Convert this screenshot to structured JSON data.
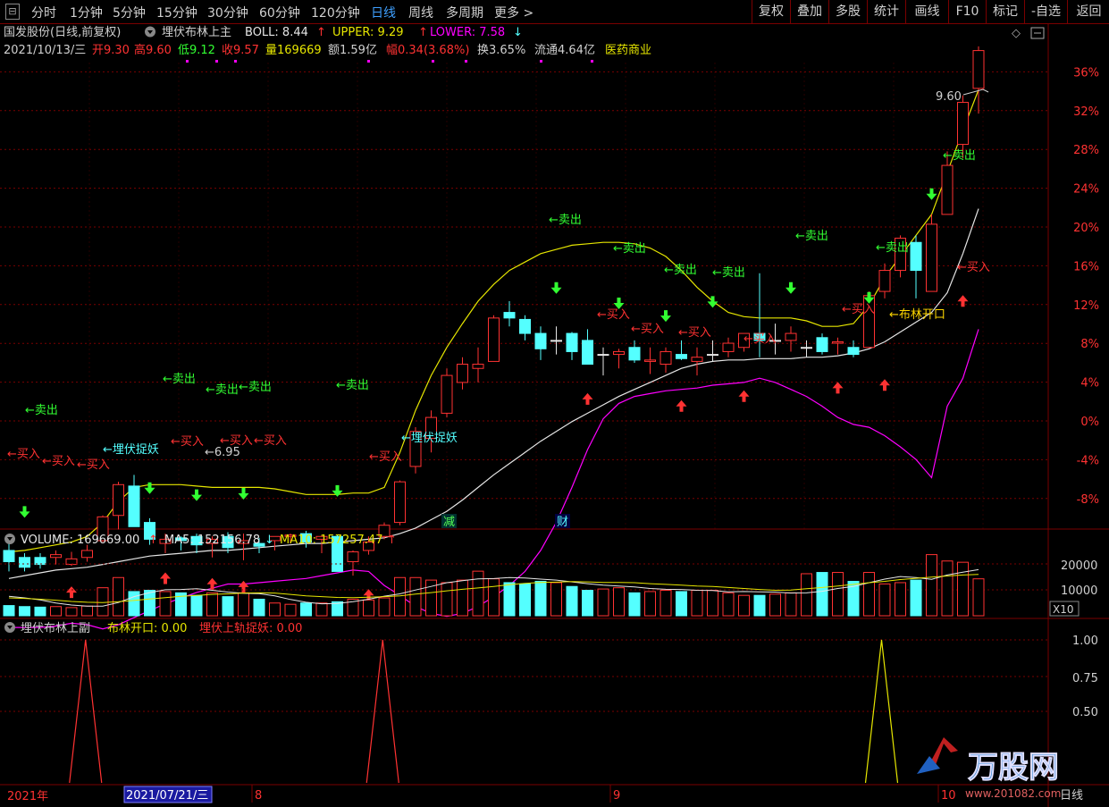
{
  "toolbar": {
    "periods": [
      "分时",
      "1分钟",
      "5分钟",
      "15分钟",
      "30分钟",
      "60分钟",
      "120分钟",
      "日线",
      "周线",
      "多周期",
      "更多 >"
    ],
    "active_period": "日线",
    "right_buttons": [
      "复权",
      "叠加",
      "多股",
      "统计",
      "画线",
      "F10",
      "标记",
      "-自选",
      "返回"
    ]
  },
  "header": {
    "stock": "国发股份(日线,前复权)",
    "indicator_name": "埋伏布林上主",
    "boll": "BOLL: 8.44",
    "upper": "UPPER: 9.29",
    "lower": "LOWER: 7.58"
  },
  "info_line": {
    "date": "2021/10/13/三",
    "open": "开9.30",
    "high": "高9.60",
    "low": "低9.12",
    "close": "收9.57",
    "volume": "量169669",
    "amount": "额1.59亿",
    "change": "幅0.34(3.68%)",
    "turnover": "换3.65%",
    "float": "流通4.64亿",
    "sector": "医药商业"
  },
  "price_axis": [
    "36%",
    "32%",
    "28%",
    "24%",
    "20%",
    "16%",
    "12%",
    "8%",
    "4%",
    "0%",
    "-4%",
    "-8%"
  ],
  "price_labels": {
    "high": "9.60",
    "low": "6.95"
  },
  "signals": {
    "sell": "←卖出",
    "buy": "←买入",
    "ambush": "埋伏捉妖",
    "ambush2": "←埋伏捉妖",
    "bollinger_open": "←布林开口",
    "jian": "减",
    "cai": "财"
  },
  "volume_header": {
    "volume": "VOLUME: 169669.00",
    "ma5": "MA5: 152156.78",
    "ma10": "MA10: 157257.47"
  },
  "volume_axis": [
    "20000",
    "10000"
  ],
  "volume_unit": "X10",
  "sub_header": {
    "name": "埋伏布林上副",
    "boll_open": "布林开口: 0.00",
    "ambush": "埋伏上轨捉妖: 0.00"
  },
  "sub_axis": [
    "1.00",
    "0.75",
    "0.50"
  ],
  "time_axis": {
    "year": "2021年",
    "cursor_date": "2021/07/21/三",
    "months": [
      "8",
      "9",
      "10"
    ]
  },
  "right_bottom_label": "日线",
  "watermark": {
    "brand": "万股网",
    "url": "www.201082.com"
  },
  "colors": {
    "up": "#ff3232",
    "down": "#54ffff",
    "upper": "#e6e600",
    "mid": "#e6e6e6",
    "lower": "#ff00ff",
    "buy": "#ff3232",
    "sell": "#32ff32",
    "grid": "#7a0000"
  },
  "chart_data": {
    "type": "candlestick",
    "candles": [
      [
        6.0,
        6.1,
        5.85,
        5.92
      ],
      [
        5.95,
        5.98,
        5.85,
        5.88
      ],
      [
        5.95,
        5.98,
        5.87,
        5.9
      ],
      [
        5.95,
        6.0,
        5.9,
        5.97
      ],
      [
        5.9,
        5.99,
        5.89,
        5.94
      ],
      [
        5.95,
        6.04,
        5.92,
        6.0
      ],
      [
        6.07,
        6.25,
        6.06,
        6.24
      ],
      [
        6.25,
        6.49,
        6.15,
        6.47
      ],
      [
        6.46,
        6.54,
        6.17,
        6.17
      ],
      [
        6.2,
        6.23,
        6.04,
        6.08
      ],
      [
        6.05,
        6.12,
        5.98,
        6.08
      ],
      [
        6.09,
        6.1,
        6.0,
        6.07
      ],
      [
        6.1,
        6.12,
        5.98,
        6.04
      ],
      [
        6.05,
        6.1,
        5.95,
        6.08
      ],
      [
        6.1,
        6.13,
        5.98,
        6.02
      ],
      [
        6.05,
        6.12,
        5.93,
        6.07
      ],
      [
        6.05,
        6.09,
        5.98,
        6.03
      ],
      [
        6.07,
        6.1,
        6.0,
        6.1
      ],
      [
        6.1,
        6.12,
        6.05,
        6.11
      ],
      [
        6.12,
        6.14,
        6.02,
        6.06
      ],
      [
        6.08,
        6.1,
        5.98,
        6.1
      ],
      [
        6.1,
        6.11,
        5.85,
        5.85
      ],
      [
        5.92,
        6.0,
        5.82,
        5.99
      ],
      [
        6.0,
        6.1,
        5.97,
        6.06
      ],
      [
        6.1,
        6.2,
        6.08,
        6.18
      ],
      [
        6.2,
        6.5,
        6.18,
        6.49
      ],
      [
        6.6,
        6.88,
        6.55,
        6.85
      ],
      [
        6.8,
        7.0,
        6.7,
        6.95
      ],
      [
        6.98,
        7.3,
        6.95,
        7.25
      ],
      [
        7.2,
        7.38,
        7.15,
        7.33
      ],
      [
        7.3,
        7.45,
        7.2,
        7.33
      ],
      [
        7.35,
        7.68,
        7.35,
        7.66
      ],
      [
        7.7,
        7.78,
        7.6,
        7.66
      ],
      [
        7.65,
        7.68,
        7.5,
        7.55
      ],
      [
        7.55,
        7.6,
        7.36,
        7.44
      ],
      [
        7.5,
        7.6,
        7.4,
        7.5
      ],
      [
        7.55,
        7.56,
        7.36,
        7.42
      ],
      [
        7.5,
        7.58,
        7.33,
        7.33
      ],
      [
        7.4,
        7.45,
        7.25,
        7.4
      ],
      [
        7.4,
        7.44,
        7.3,
        7.42
      ],
      [
        7.45,
        7.5,
        7.34,
        7.36
      ],
      [
        7.35,
        7.45,
        7.26,
        7.36
      ],
      [
        7.33,
        7.45,
        7.27,
        7.42
      ],
      [
        7.4,
        7.5,
        7.36,
        7.37
      ],
      [
        7.35,
        7.45,
        7.25,
        7.38
      ],
      [
        7.4,
        7.5,
        7.35,
        7.4
      ],
      [
        7.42,
        7.52,
        7.38,
        7.48
      ],
      [
        7.45,
        7.55,
        7.42,
        7.55
      ],
      [
        7.55,
        7.98,
        7.38,
        7.5
      ],
      [
        7.5,
        7.62,
        7.4,
        7.5
      ],
      [
        7.5,
        7.6,
        7.42,
        7.55
      ],
      [
        7.45,
        7.5,
        7.38,
        7.45
      ],
      [
        7.52,
        7.55,
        7.4,
        7.42
      ],
      [
        7.48,
        7.52,
        7.4,
        7.49
      ],
      [
        7.45,
        7.5,
        7.38,
        7.4
      ],
      [
        7.45,
        7.85,
        7.45,
        7.82
      ],
      [
        7.85,
        8.05,
        7.8,
        8.0
      ],
      [
        8.0,
        8.25,
        7.95,
        8.23
      ],
      [
        8.2,
        8.25,
        7.8,
        8.0
      ],
      [
        7.85,
        8.4,
        7.85,
        8.33
      ],
      [
        8.4,
        8.85,
        8.4,
        8.75
      ],
      [
        8.9,
        9.25,
        8.8,
        9.2
      ],
      [
        9.3,
        9.6,
        9.12,
        9.57
      ]
    ],
    "volume": [
      4,
      3.6,
      3.4,
      3.6,
      3.2,
      3.8,
      11,
      15,
      9.5,
      10,
      9.5,
      9,
      8,
      9,
      7.5,
      9,
      6.5,
      5,
      4.5,
      5,
      5,
      5.5,
      6.5,
      6.2,
      7,
      15,
      15,
      14,
      13,
      14,
      17.5,
      14.5,
      13,
      12.5,
      13.5,
      13,
      11.5,
      10,
      10.5,
      11,
      9,
      9.5,
      10,
      9.5,
      10,
      10,
      9,
      8,
      8,
      8.5,
      9,
      16.5,
      17,
      17,
      13.5,
      17,
      12.5,
      13,
      14,
      24,
      21.5,
      21,
      14.5,
      13.5,
      13,
      16.5
    ],
    "ma5": [
      7.6,
      7.0,
      6.2,
      5.0,
      4.2,
      3.8,
      3.8,
      5.2,
      7.5,
      9.1,
      10.2,
      10.3,
      10.6,
      10.0,
      9.3,
      8.8,
      8.7,
      7.8,
      6.4,
      5.3,
      4.7,
      4.8,
      5.5,
      6.5,
      7.7,
      8.6,
      10.1,
      11.5,
      13.0,
      13.8,
      14.5,
      14.6,
      15.0,
      14.8,
      14.4,
      14.0,
      13.3,
      12.6,
      12.0,
      11.7,
      11.3,
      10.7,
      10.4,
      10.3,
      10.0,
      9.9,
      9.4,
      9.5,
      9.4,
      9.3,
      8.9,
      9.0,
      9.6,
      10.7,
      11.5,
      13.0,
      14.4,
      15.4,
      15.0,
      14.3,
      16.0,
      17.1,
      18.1,
      17.8,
      16.9,
      16.5
    ],
    "ma10": [
      7.0,
      6.8,
      6.5,
      6.1,
      5.6,
      5.3,
      5.2,
      5.5,
      6.0,
      6.6,
      7.1,
      7.6,
      8.0,
      8.4,
      8.6,
      8.9,
      9.0,
      8.9,
      8.4,
      7.8,
      7.5,
      7.2,
      7.1,
      7.3,
      7.5,
      7.8,
      8.5,
      9.1,
      9.8,
      10.4,
      10.9,
      11.5,
      12.2,
      12.7,
      13.1,
      13.2,
      13.4,
      13.3,
      13.1,
      13.1,
      13.0,
      12.6,
      12.3,
      12.0,
      11.7,
      11.5,
      11.1,
      10.7,
      10.3,
      10.0,
      10.1,
      10.6,
      11.1,
      11.7,
      12.3,
      13.0,
      13.5,
      14.2,
      14.7,
      15.2,
      15.6,
      16.0,
      16.2,
      16.3,
      15.9,
      15.7
    ],
    "upper": [
      5.99,
      6.0,
      6.02,
      6.04,
      6.06,
      6.1,
      6.2,
      6.35,
      6.45,
      6.47,
      6.47,
      6.47,
      6.46,
      6.45,
      6.45,
      6.45,
      6.45,
      6.44,
      6.42,
      6.4,
      6.4,
      6.4,
      6.41,
      6.41,
      6.45,
      6.7,
      7.0,
      7.25,
      7.45,
      7.62,
      7.78,
      7.9,
      8.0,
      8.06,
      8.12,
      8.15,
      8.18,
      8.19,
      8.2,
      8.2,
      8.19,
      8.16,
      8.1,
      8.0,
      7.88,
      7.78,
      7.7,
      7.67,
      7.66,
      7.66,
      7.66,
      7.64,
      7.6,
      7.6,
      7.62,
      7.75,
      7.95,
      8.1,
      8.25,
      8.4,
      8.7,
      9.0,
      9.29
    ],
    "mid": [
      5.8,
      5.82,
      5.84,
      5.86,
      5.87,
      5.88,
      5.9,
      5.92,
      5.94,
      5.96,
      5.97,
      5.98,
      5.99,
      6.0,
      6.0,
      6.01,
      6.02,
      6.03,
      6.04,
      6.05,
      6.05,
      6.06,
      6.07,
      6.08,
      6.09,
      6.12,
      6.16,
      6.22,
      6.28,
      6.36,
      6.45,
      6.54,
      6.62,
      6.7,
      6.78,
      6.85,
      6.92,
      6.98,
      7.04,
      7.1,
      7.15,
      7.2,
      7.25,
      7.3,
      7.33,
      7.35,
      7.36,
      7.36,
      7.37,
      7.37,
      7.37,
      7.38,
      7.38,
      7.39,
      7.41,
      7.44,
      7.49,
      7.56,
      7.63,
      7.7,
      7.84,
      8.12,
      8.44
    ],
    "lower": [
      5.45,
      5.45,
      5.45,
      5.46,
      5.48,
      5.47,
      5.44,
      5.47,
      5.52,
      5.57,
      5.62,
      5.66,
      5.7,
      5.73,
      5.76,
      5.76,
      5.77,
      5.78,
      5.79,
      5.8,
      5.82,
      5.84,
      5.86,
      5.85,
      5.75,
      5.68,
      5.6,
      5.55,
      5.53,
      5.55,
      5.6,
      5.67,
      5.75,
      5.85,
      6.0,
      6.2,
      6.45,
      6.72,
      6.94,
      7.05,
      7.1,
      7.12,
      7.14,
      7.15,
      7.16,
      7.18,
      7.19,
      7.2,
      7.23,
      7.2,
      7.15,
      7.1,
      7.03,
      6.95,
      6.9,
      6.88,
      6.82,
      6.74,
      6.65,
      6.52,
      7.03,
      7.23,
      7.58
    ],
    "sub_signal": {
      "布林开口": [
        [
          55.8,
          1
        ]
      ],
      "埋伏上轨捉妖": [
        [
          4.9,
          1
        ],
        [
          23.9,
          1
        ]
      ]
    }
  }
}
